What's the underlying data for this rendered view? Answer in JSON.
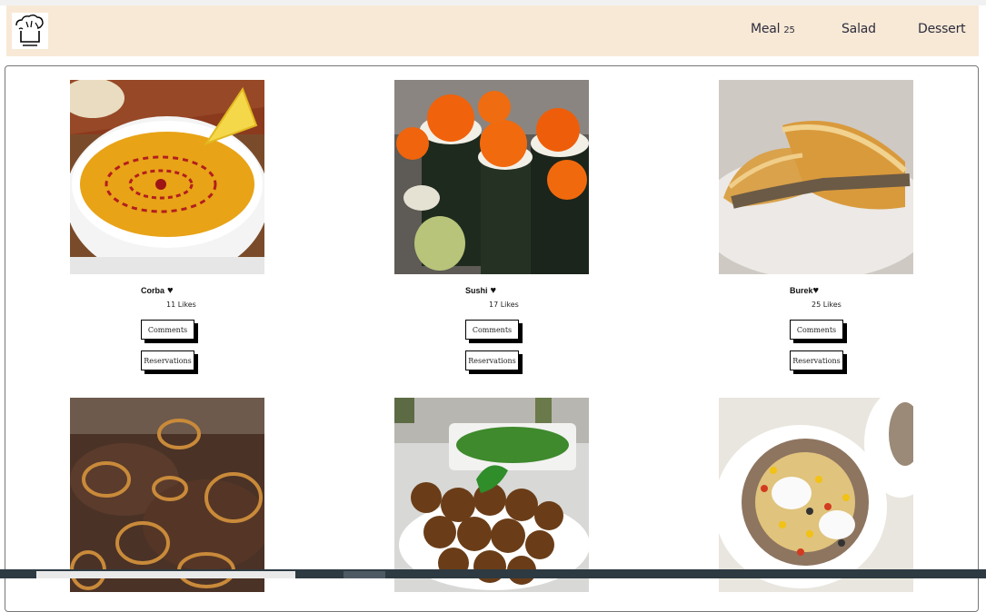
{
  "header": {
    "logo_text": "CHEF",
    "nav": [
      {
        "label": "Meal",
        "count": "25"
      },
      {
        "label": "Salad"
      },
      {
        "label": "Dessert"
      }
    ]
  },
  "buttons": {
    "comments": "Comments",
    "reservations": "Reservations"
  },
  "meals": [
    {
      "name": "Corba",
      "likes": "11 Likes",
      "image": "soup"
    },
    {
      "name": "Sushi",
      "likes": "17 Likes",
      "image": "sushi"
    },
    {
      "name": "Burek",
      "likes": "25 Likes",
      "image": "pastry"
    },
    {
      "name": "",
      "likes": "",
      "image": "liver-onions"
    },
    {
      "name": "",
      "likes": "",
      "image": "falafel"
    },
    {
      "name": "",
      "likes": "",
      "image": "baked-potato"
    }
  ],
  "icons": {
    "like": "heart-icon"
  }
}
